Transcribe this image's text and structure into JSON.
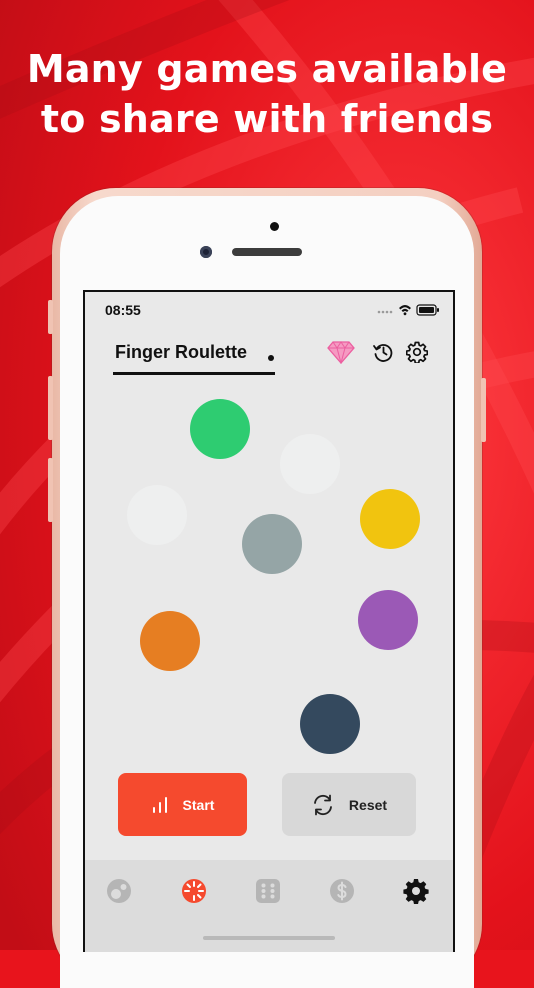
{
  "headline": {
    "line1": "Many games available",
    "line2": "to share with friends"
  },
  "status_bar": {
    "time": "08:55",
    "icons": [
      "signal-icon",
      "wifi-icon",
      "battery-icon"
    ]
  },
  "app": {
    "title": "Finger Roulette",
    "header_icons": [
      "diamond-icon",
      "history-icon",
      "gear-icon"
    ]
  },
  "player_dots": [
    {
      "color": "#2ecc71"
    },
    {
      "color": "#eeefef"
    },
    {
      "color": "#eeefef"
    },
    {
      "color": "#f1c40f"
    },
    {
      "color": "#95a5a6"
    },
    {
      "color": "#e67e22"
    },
    {
      "color": "#9b59b6"
    },
    {
      "color": "#34495e"
    }
  ],
  "buttons": {
    "start_label": "Start",
    "reset_label": "Reset"
  },
  "tabbar": {
    "tabs": [
      {
        "icon": "bubbles-icon",
        "active": false
      },
      {
        "icon": "roulette-icon",
        "active": true
      },
      {
        "icon": "dice-icon",
        "active": false
      },
      {
        "icon": "dollar-icon",
        "active": false
      },
      {
        "icon": "gear-icon",
        "active": false
      }
    ]
  },
  "colors": {
    "background": "#e8141c",
    "accent": "#f54a2e",
    "screen_bg": "#e9e9e9"
  }
}
